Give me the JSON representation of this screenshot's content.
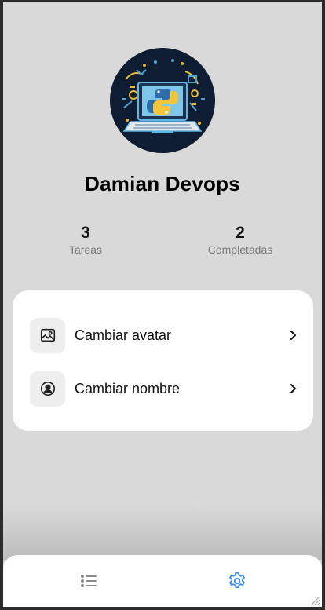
{
  "profile": {
    "name": "Damian Devops",
    "avatar": "python-laptop-illustration"
  },
  "stats": [
    {
      "value": "3",
      "label": "Tareas"
    },
    {
      "value": "2",
      "label": "Completadas"
    }
  ],
  "settings": {
    "items": [
      {
        "label": "Cambiar avatar",
        "icon": "image-icon"
      },
      {
        "label": "Cambiar nombre",
        "icon": "user-circle-icon"
      }
    ]
  },
  "bottom_nav": {
    "items": [
      {
        "icon": "list-icon",
        "active": false
      },
      {
        "icon": "gear-icon",
        "active": true
      }
    ],
    "active_color": "#3b8df5",
    "inactive_color": "#8c8c8c"
  }
}
